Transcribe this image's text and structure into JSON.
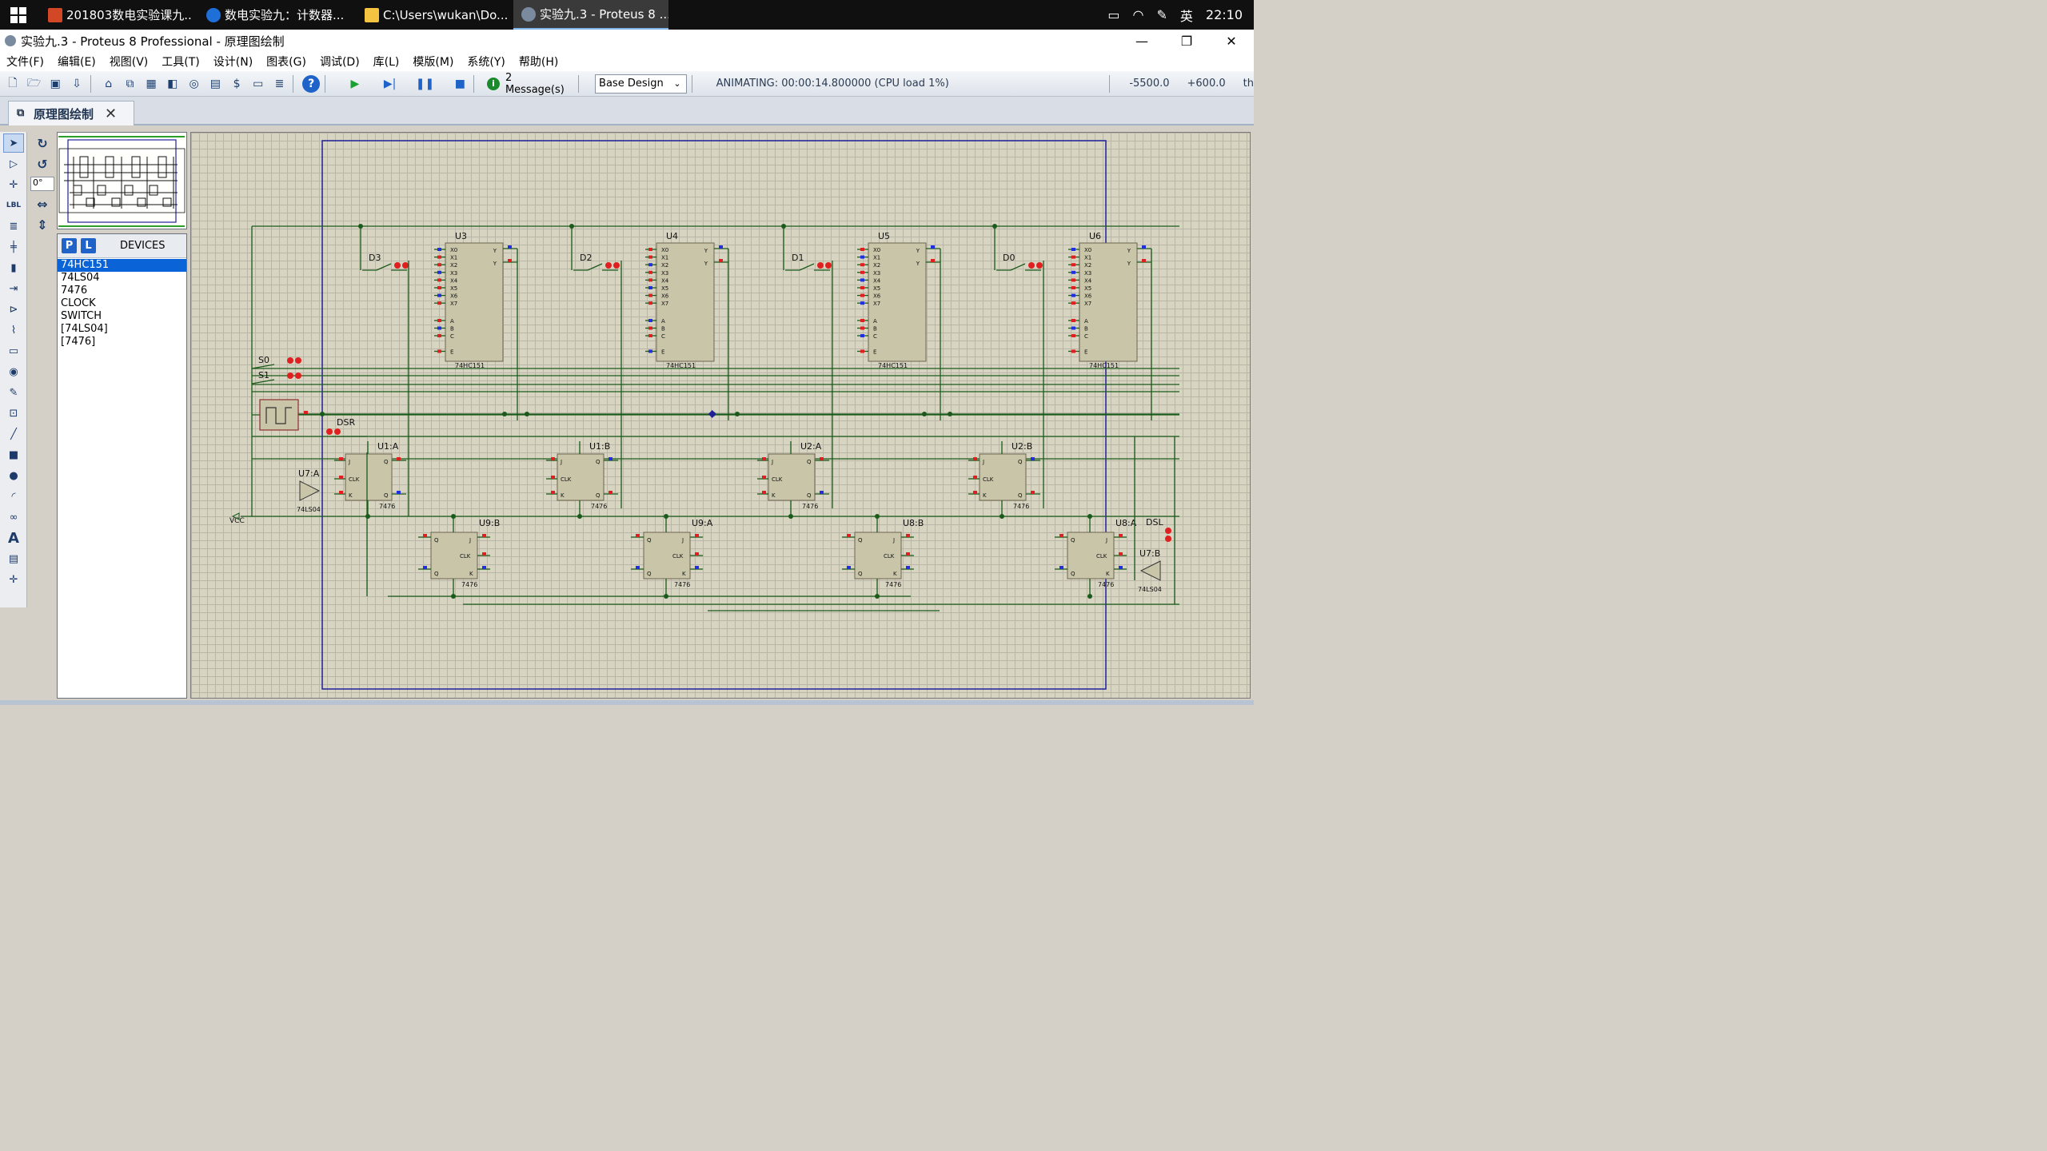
{
  "taskbar": {
    "tasks": [
      {
        "label": "201803数电实验课九...",
        "icon_color": "#d24726"
      },
      {
        "label": "数电实验九：计数器...",
        "icon_color": "#1f6fd8"
      },
      {
        "label": "C:\\Users\\wukan\\Do...",
        "icon_color": "#f5c342"
      },
      {
        "label": "实验九.3 - Proteus 8 ...",
        "icon_color": "#7a8ba0"
      }
    ],
    "tray_ime": "英",
    "clock": "22:10"
  },
  "window": {
    "title": "实验九.3 - Proteus 8 Professional - 原理图绘制",
    "minimize": "—",
    "restore": "❐",
    "close": "✕"
  },
  "menu": [
    "文件(F)",
    "编辑(E)",
    "视图(V)",
    "工具(T)",
    "设计(N)",
    "图表(G)",
    "调试(D)",
    "库(L)",
    "模版(M)",
    "系统(Y)",
    "帮助(H)"
  ],
  "toolbar": {
    "messages": "2 Message(s)",
    "design_select": "Base Design",
    "status": "ANIMATING: 00:00:14.800000 (CPU load 1%)",
    "coord_x": "-5500.0",
    "coord_y": "+600.0",
    "unit": "th"
  },
  "tab": {
    "label": "原理图绘制"
  },
  "rotation": {
    "value": "0°"
  },
  "devices": {
    "header": "DEVICES",
    "p_label": "P",
    "l_label": "L",
    "items": [
      "74HC151",
      "74LS04",
      "7476",
      "CLOCK",
      "SWITCH",
      "[74LS04]",
      "[7476]"
    ],
    "selected_index": 0
  },
  "schematic": {
    "muxes": [
      {
        "ref": "U3",
        "type": "74HC151",
        "switch": "D3"
      },
      {
        "ref": "U4",
        "type": "74HC151",
        "switch": "D2"
      },
      {
        "ref": "U5",
        "type": "74HC151",
        "switch": "D1"
      },
      {
        "ref": "U6",
        "type": "74HC151",
        "switch": "D0"
      }
    ],
    "mux_pins_left": [
      "X0",
      "X1",
      "X2",
      "X3",
      "X4",
      "X5",
      "X6",
      "X7",
      "A",
      "B",
      "C",
      "E"
    ],
    "mux_pins_right": [
      "Y",
      "Y"
    ],
    "flipflops_top": [
      {
        "ref": "U1:A",
        "type": "7476"
      },
      {
        "ref": "U1:B",
        "type": "7476"
      },
      {
        "ref": "U2:A",
        "type": "7476"
      },
      {
        "ref": "U2:B",
        "type": "7476"
      }
    ],
    "flipflops_bottom": [
      {
        "ref": "U9:B",
        "type": "7476"
      },
      {
        "ref": "U9:A",
        "type": "7476"
      },
      {
        "ref": "U8:B",
        "type": "7476"
      },
      {
        "ref": "U8:A",
        "type": "7476"
      }
    ],
    "inverters": [
      {
        "ref": "U7:A",
        "type": "74LS04"
      },
      {
        "ref": "U7:B",
        "type": "74LS04"
      }
    ],
    "labels": {
      "s0": "S0",
      "s1": "S1",
      "dsr": "DSR",
      "dsl": "DSL",
      "vcc": "VCC"
    },
    "colors": {
      "wire": "#1a5a1a",
      "body": "#c8c5a8",
      "pin_high": "#e02020",
      "pin_low": "#2030e0",
      "frame": "#20209a"
    }
  }
}
